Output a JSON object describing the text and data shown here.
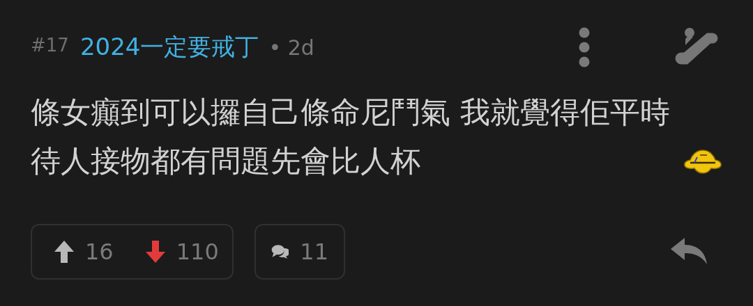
{
  "post": {
    "number": "#17",
    "author": "2024一定要戒丁",
    "age": "• 2d",
    "body": "條女癲到可以攞自己條命尼鬥氣 我就覺得佢平時待人接物都有問題先會比人杯"
  },
  "votes": [
    {
      "kind": "up",
      "count": "16",
      "selected": false
    },
    {
      "kind": "down",
      "count": "110",
      "selected": true
    }
  ],
  "comments": {
    "count": "11"
  }
}
